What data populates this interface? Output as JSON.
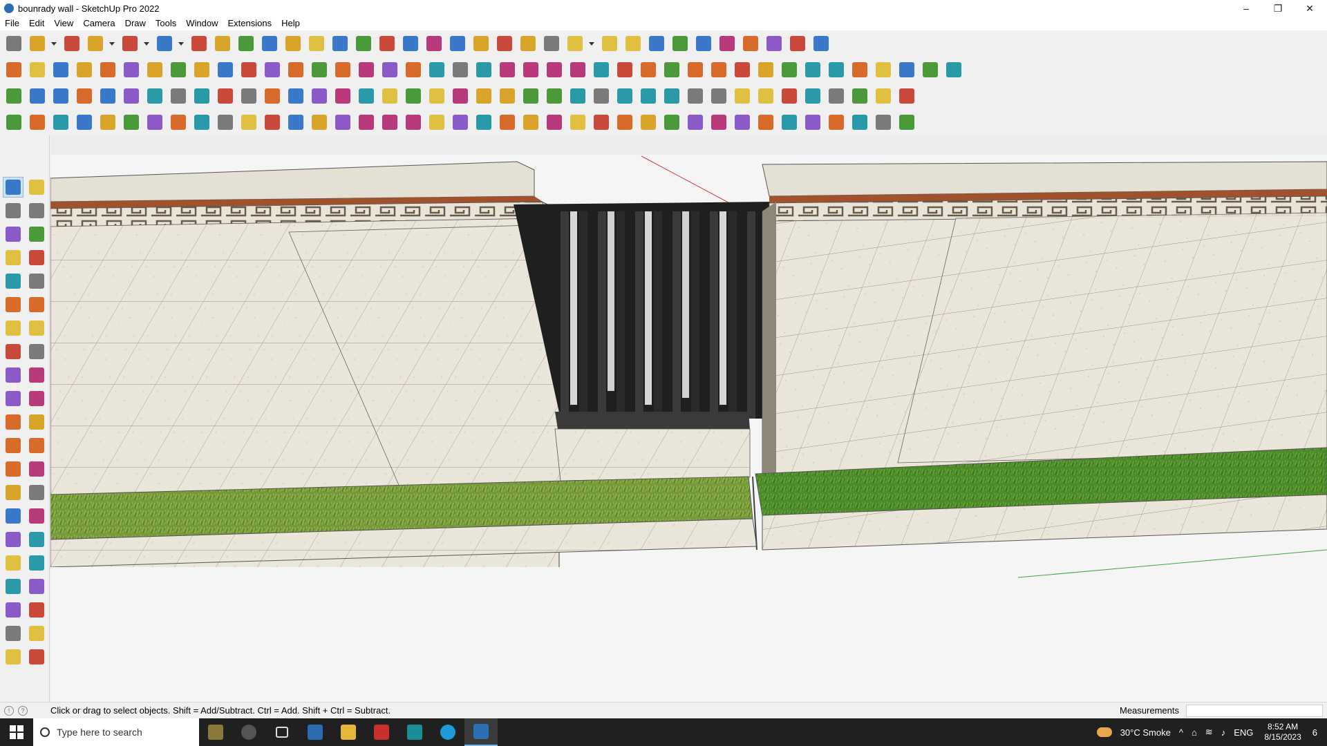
{
  "window": {
    "title": "bounrady wall - SketchUp Pro 2022",
    "minimize_glyph": "–",
    "restore_glyph": "❐",
    "close_glyph": "✕"
  },
  "menu": [
    "File",
    "Edit",
    "View",
    "Camera",
    "Draw",
    "Tools",
    "Window",
    "Extensions",
    "Help"
  ],
  "toolbars": {
    "row1": [
      "zoom-icon",
      "select-icon",
      "dropdown",
      "eraser-icon",
      "line-icon",
      "dropdown",
      "arc-icon",
      "dropdown",
      "rectangle-icon",
      "dropdown",
      "push-pull-icon",
      "follow-me-icon",
      "move-icon",
      "rotate-icon",
      "scale-icon",
      "tape-measure-icon",
      "text-icon",
      "paint-bucket-icon",
      "orbit-icon",
      "pan-icon",
      "zoom-window-icon",
      "zoom-extents-icon",
      "components-icon",
      "layers-icon",
      "styles-icon",
      "scenes-icon",
      "account-icon",
      "dropdown",
      "solid-tools-icon",
      "sandbox-icon",
      "axes-icon",
      "flip-icon",
      "flip-along-icon",
      "section-plane-icon",
      "align-icon",
      "undo-icon",
      "redo-icon",
      "warehouse-icon"
    ],
    "row2": [
      "iso-view-icon",
      "top-view-icon",
      "front-view-icon",
      "move-sel-icon",
      "push-blue-icon",
      "push-red-icon",
      "push-green-icon",
      "push-orange-icon",
      "push-magenta-icon",
      "curve-icon",
      "plane-icon",
      "plane2-icon",
      "plane3-icon",
      "green-box-icon",
      "green-face-icon",
      "house-icon",
      "house2-icon",
      "house3-icon",
      "house4-icon",
      "house5-icon",
      "fx-icon",
      "tag-icon",
      "measure-icon",
      "circle-icon",
      "circle2-icon",
      "polygon-icon",
      "ellipse-icon",
      "parallelogram-icon",
      "arc3-icon",
      "bezier-icon",
      "spline-icon",
      "lasso-icon",
      "red-line-icon",
      "pink-eraser-icon",
      "roof-icon",
      "grid-icon",
      "truss-icon",
      "stair-icon",
      "stair2-icon",
      "box-icon",
      "diamond-icon"
    ],
    "row3": [
      "plane-blue-icon",
      "plane-blue2-icon",
      "plane-gold-icon",
      "text-a-icon",
      "red-shape-icon",
      "outline-icon",
      "loop-icon",
      "red-square-icon",
      "list-icon",
      "curve-sel-icon",
      "hinge-icon",
      "chain-icon",
      "corner-icon",
      "dots-icon",
      "cross-red-icon",
      "cross-green-icon",
      "cross-blue-icon",
      "cone-icon",
      "cone2-icon",
      "triangle-icon",
      "arc-o-icon",
      "arc-o2-icon",
      "arc-o3-icon",
      "move4-icon",
      "bucket-icon",
      "hook-icon",
      "tree-icon",
      "sections-icon",
      "sections2-icon",
      "sections3-icon",
      "gem-icon",
      "grid3-icon",
      "frame-icon",
      "tile-icon",
      "tile2-icon",
      "tile3-icon",
      "explode-icon",
      "curve2-icon",
      "grid4-icon"
    ],
    "row4": [
      "path-icon",
      "spline2-icon",
      "car-icon",
      "red-gem-icon",
      "shape1-icon",
      "shape2-icon",
      "shape3-icon",
      "shape4-icon",
      "shape5-icon",
      "shape6-icon",
      "line1-icon",
      "line2-icon",
      "line3-icon",
      "line4-icon",
      "door-icon",
      "cut-icon",
      "rail-icon",
      "rail2-icon",
      "hand-icon",
      "leaf-icon",
      "leaf2-icon",
      "fan-icon",
      "blade-icon",
      "blade2-icon",
      "blade3-icon",
      "blade4-icon",
      "stamp-icon",
      "stair3-icon",
      "stair4-icon",
      "stair5-icon",
      "pattern-icon",
      "pattern2-icon",
      "pattern3-icon",
      "pattern4-icon",
      "gear1-icon",
      "gear2-icon",
      "gear3-icon",
      "gear4-icon",
      "pin-icon"
    ]
  },
  "left_tools": [
    "select-tool-icon",
    "orbit-tool-icon",
    "paint-tool-icon",
    "eraser-tool-icon",
    "component-tool-icon",
    "tape-tool-icon",
    "line-tool-icon",
    "freehand-tool-icon",
    "rectangle-tool-icon",
    "rot-rect-tool-icon",
    "circle-tool-icon",
    "polygon-tool-icon",
    "arc-tool-icon",
    "arc2-tool-icon",
    "arc3-tool-icon",
    "pie-tool-icon",
    "move-tool-icon",
    "pushpull-tool-icon",
    "rotate-tool-icon",
    "followme-tool-icon",
    "scale-tool-icon",
    "offset-tool-icon",
    "measure-tool-icon",
    "dimension-tool-icon",
    "protractor-tool-icon",
    "text-tool-icon",
    "axes-tool-icon",
    "3dtext-tool-icon",
    "orbit2-tool-icon",
    "pan-tool-icon",
    "zoom-tool-icon",
    "zoomwin-tool-icon",
    "zoomext-tool-icon",
    "prev-view-tool-icon",
    "walk-tool-icon",
    "look-tool-icon",
    "footprint-tool-icon",
    "position-cam-tool-icon",
    "outliner-tool-icon",
    "layers-tool-icon",
    "layers2-tool-icon",
    "layers3-tool-icon"
  ],
  "status": {
    "hint": "Click or drag to select objects. Shift = Add/Subtract. Ctrl = Add. Shift + Ctrl = Subtract.",
    "measurements_label": "Measurements",
    "measurements_value": "",
    "info1": "!",
    "info2": "?"
  },
  "taskbar": {
    "search_placeholder": "Type here to search",
    "weather": "30°C  Smoke",
    "language": "ENG",
    "time": "8:52 AM",
    "date": "8/15/2023",
    "notifications": "6",
    "tray_up": "^"
  },
  "colors": {
    "accent": "#0078d7",
    "wall_stone": "#e8e3d8",
    "grass": "#4f8a2c",
    "gate": "#2a2a2a",
    "brick": "#9a4e2c"
  }
}
